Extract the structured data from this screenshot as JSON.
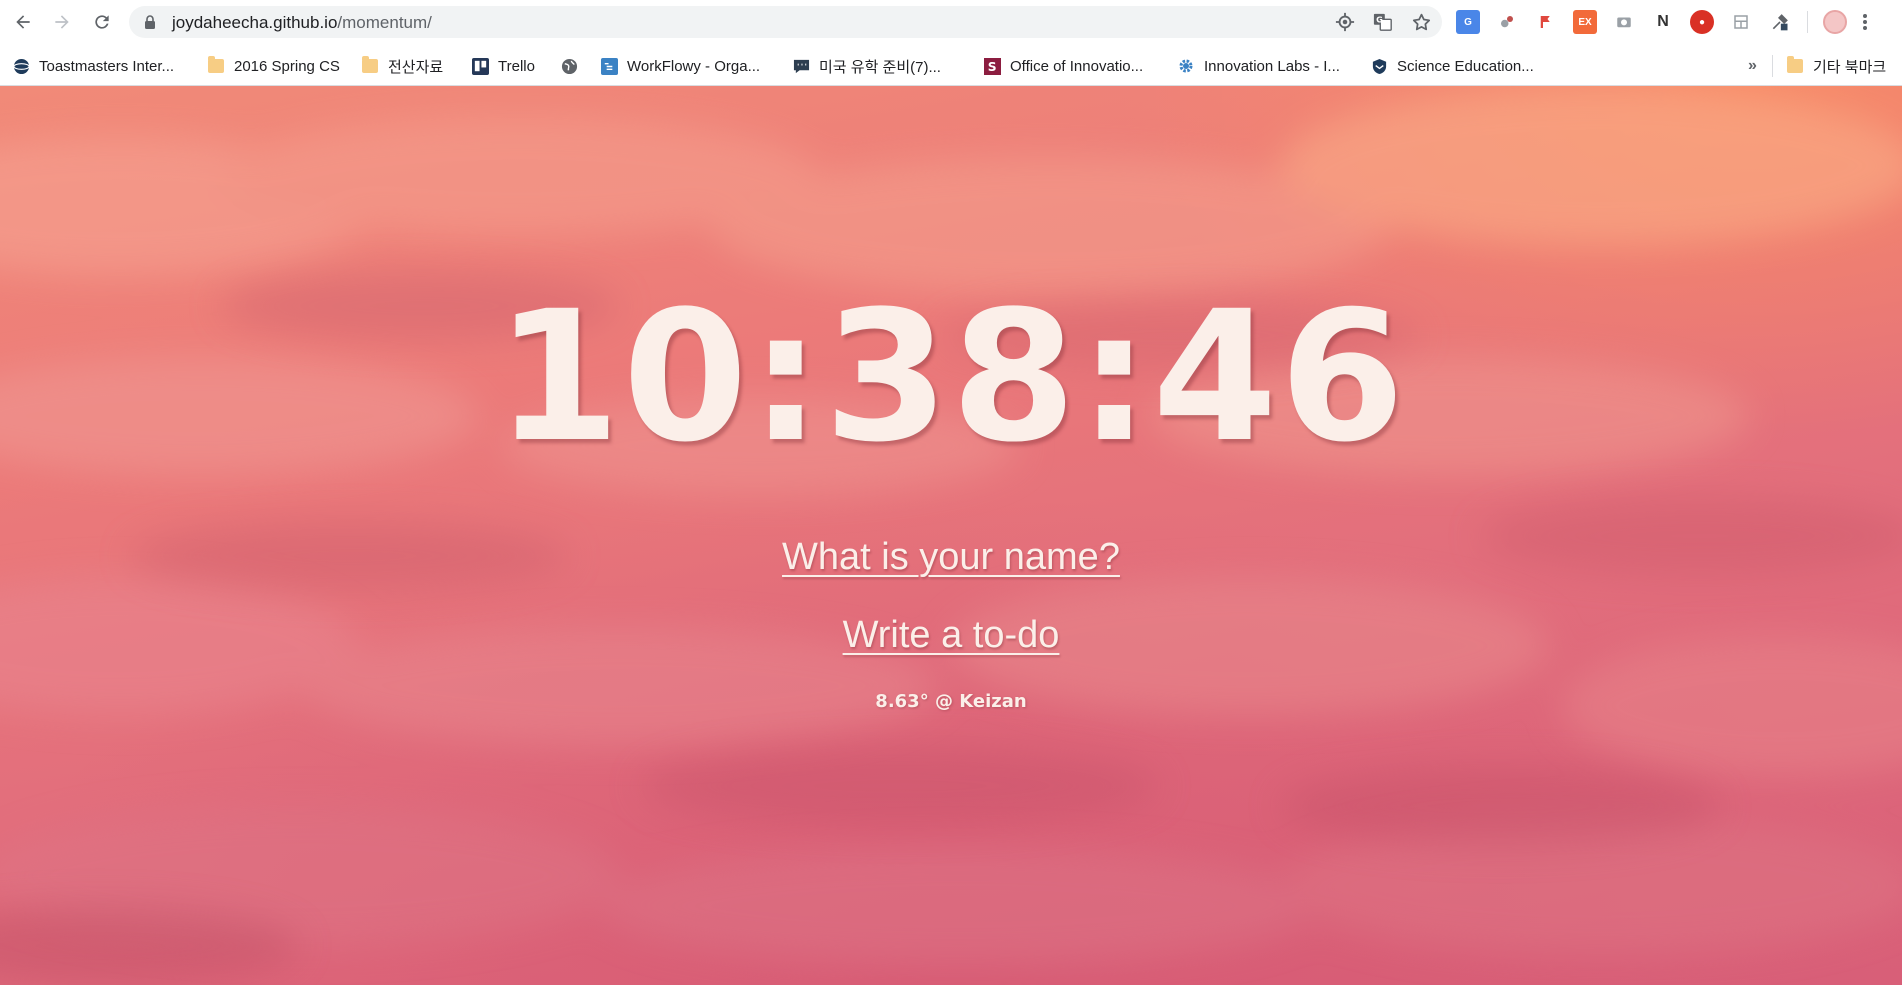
{
  "browser": {
    "url_host": "joydaheecha.github.io",
    "url_path": "/momentum/"
  },
  "bookmarks": [
    {
      "label": "Toastmasters Inter...",
      "icon": "globe-icon"
    },
    {
      "label": "2016 Spring CS",
      "icon": "folder-icon"
    },
    {
      "label": "전산자료",
      "icon": "folder-icon"
    },
    {
      "label": "Trello",
      "icon": "trello-icon"
    },
    {
      "label": "",
      "icon": "globe-icon"
    },
    {
      "label": "WorkFlowy - Orga...",
      "icon": "workflowy-icon"
    },
    {
      "label": "미국 유학 준비(7)...",
      "icon": "chat-icon"
    },
    {
      "label": "Office of Innovatio...",
      "icon": "s-logo-icon"
    },
    {
      "label": "Innovation Labs - I...",
      "icon": "gear-icon"
    },
    {
      "label": "Science Education...",
      "icon": "shield-icon"
    }
  ],
  "other_bookmarks": "기타 북마크",
  "overflow": "»",
  "clock": "10:38:46",
  "name_prompt": "What is your name?",
  "todo_prompt": "Write a to-do",
  "weather": "8.63° @ Keizan",
  "colors": {
    "sky_top": "#f18a78",
    "sky_bottom": "#d85f78",
    "text": "#fbefe9"
  }
}
